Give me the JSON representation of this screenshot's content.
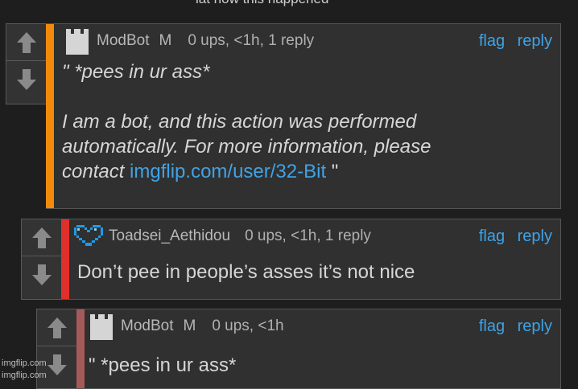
{
  "top_text": "lat how this happened",
  "comments": [
    {
      "username": "ModBot",
      "badge": "M",
      "meta": "0 ups, <1h, 1 reply",
      "flag": "flag",
      "reply": "reply",
      "stripe_color": "#f28a0c",
      "avatar_icon": "castle-icon",
      "line1": "\" *pees in ur ass*",
      "line2": "I am a bot, and this action was performed",
      "line3": "automatically. For more information, please",
      "line4_prefix": "contact ",
      "link": "imgflip.com/user/32-Bit",
      "line4_suffix": " \""
    },
    {
      "username": "Toadsei_Aethidou",
      "meta": "0 ups, <1h, 1 reply",
      "flag": "flag",
      "reply": "reply",
      "stripe_color": "#e0302b",
      "avatar_icon": "pixel-heart-icon",
      "text": "Don’t pee in people’s asses it’s not nice"
    },
    {
      "username": "ModBot",
      "badge": "M",
      "meta": "0 ups, <1h",
      "flag": "flag",
      "reply": "reply",
      "stripe_color": "#a55a5a",
      "avatar_icon": "castle-icon",
      "text": "\" *pees in ur ass*"
    }
  ],
  "watermark": "imgflip.com"
}
